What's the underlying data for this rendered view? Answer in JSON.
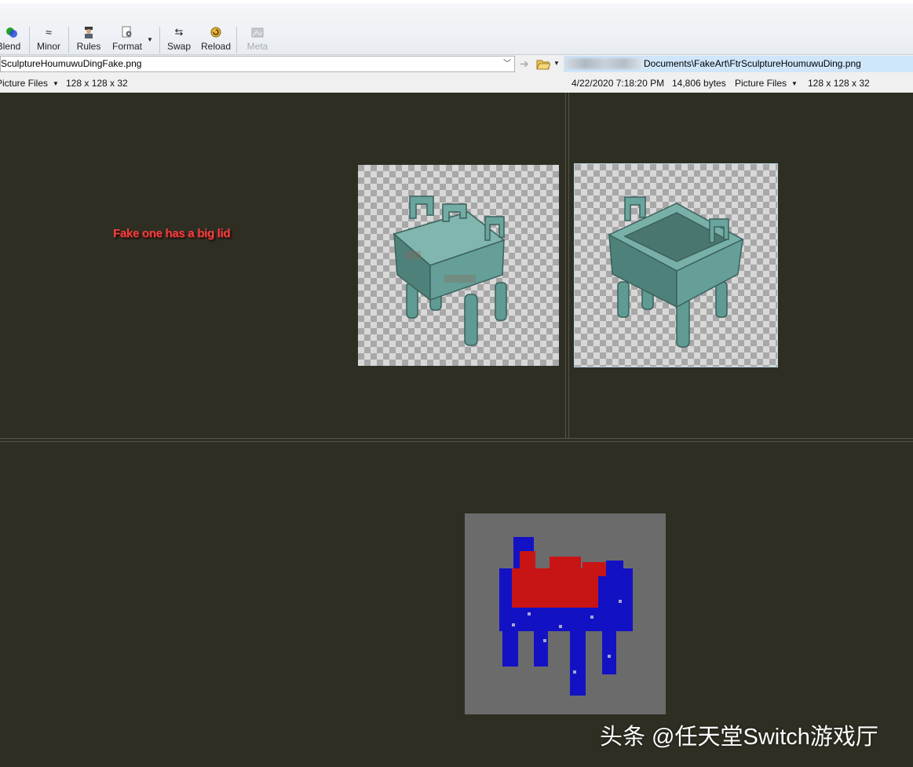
{
  "toolbar": {
    "blend": "Blend",
    "minor": "Minor",
    "rules": "Rules",
    "format": "Format",
    "swap": "Swap",
    "reload": "Reload",
    "meta": "Meta"
  },
  "left_file": {
    "path": "SculptureHoumuwuDingFake.png",
    "type": "Picture Files",
    "dimensions": "128 x 128 x 32"
  },
  "right_file": {
    "path": "Documents\\FakeArt\\FtrSculptureHoumuwuDing.png",
    "date": "4/22/2020 7:18:20 PM",
    "size": "14,806 bytes",
    "type": "Picture Files",
    "dimensions": "128 x 128 x 32"
  },
  "annotation": "Fake one has a big lid",
  "watermark": "头条 @任天堂Switch游戏厅",
  "colors": {
    "pane_background": "#2f2e23",
    "diff_background": "#6b6b6b",
    "diff_match": "#1010c8",
    "diff_mismatch": "#c81414",
    "annotation": "#e8413f"
  }
}
